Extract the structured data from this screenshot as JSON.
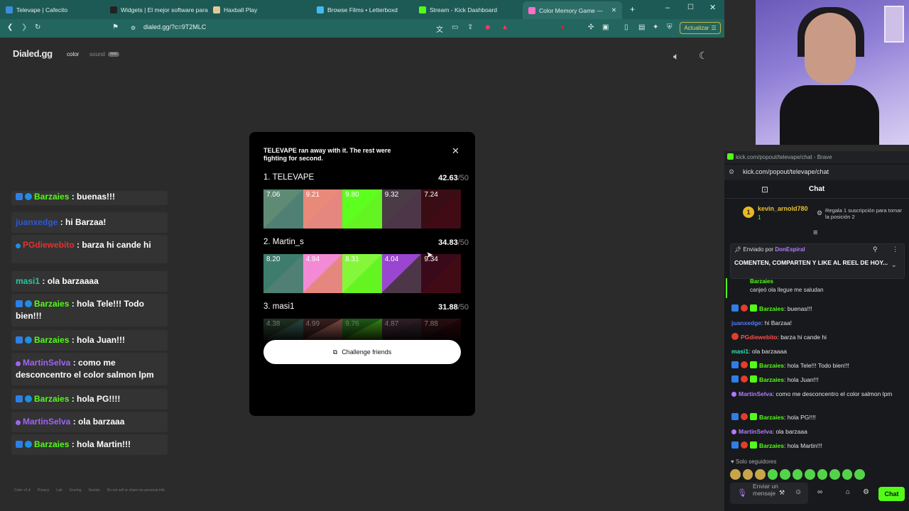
{
  "browser": {
    "tabs": [
      {
        "label": "Televape | Cafecito",
        "color": "#3c8dde"
      },
      {
        "label": "Widgets | El mejor software para",
        "color": "#222222"
      },
      {
        "label": "Haxball Play",
        "color": "#e3c89a"
      },
      {
        "label": "Browse Films • Letterboxd",
        "color": "#40bcf4"
      },
      {
        "label": "Stream - Kick Dashboard",
        "color": "#53fc18"
      },
      {
        "label": "Color Memory Game —",
        "color": "#ff6ec7"
      }
    ],
    "url": "dialed.gg/?c=9T2MLC",
    "update_label": "Actualizar"
  },
  "site": {
    "logo": "Dialed.gg",
    "nav_color": "color",
    "nav_sound": "sound",
    "new_badge": "new",
    "footer": [
      "Color v1.4",
      "Privacy",
      "Lab",
      "Scoring",
      "Socials",
      "Do not sell or share my personal info"
    ]
  },
  "overlay_chat": [
    {
      "user": "Barzaies",
      "color": "#53fc18",
      "text": "buenas!!!"
    },
    {
      "user": "juanxedge",
      "color": "#2f58d6",
      "text": "hi Barzaa!"
    },
    {
      "user": "PGdiewebito",
      "color": "#e8302c",
      "text": "barza hi cande hi"
    },
    {
      "user": "masi1",
      "color": "#25c8a0",
      "text": "ola barzaaaa"
    },
    {
      "user": "Barzaies",
      "color": "#53fc18",
      "text": "hola Tele!!! Todo bien!!!"
    },
    {
      "user": "Barzaies",
      "color": "#53fc18",
      "text": "hola Juan!!!"
    },
    {
      "user": "MartinSelva",
      "color": "#a063f2",
      "text": "como me desconcentro el color salmon lpm"
    },
    {
      "user": "Barzaies",
      "color": "#53fc18",
      "text": "hola PG!!!!"
    },
    {
      "user": "MartinSelva",
      "color": "#a063f2",
      "text": "ola barzaaa"
    },
    {
      "user": "Barzaies",
      "color": "#53fc18",
      "text": "hola Martin!!!"
    }
  ],
  "modal": {
    "title": "TELEVAPE ran away with it. The rest were fighting for second.",
    "max": "/50",
    "challenge_label": "Challenge friends",
    "players": [
      {
        "rank": "1. TELEVAPE",
        "score": "42.63",
        "scores": [
          "7.06",
          "9.21",
          "9.80",
          "9.32",
          "7.24"
        ],
        "colors": [
          "#5f8a74",
          "#e8897a",
          "#5dff1f",
          "#4a3b47",
          "#3a0d14"
        ],
        "guesses": [
          "#4f8073",
          "#e5877e",
          "#63f422",
          "#4d3648",
          "#410b16"
        ]
      },
      {
        "rank": "2. Martin_s",
        "score": "34.83",
        "scores": [
          "8.20",
          "4.94",
          "8.31",
          "4.04",
          "9.34"
        ],
        "colors": [
          "#3e7d6d",
          "#f38ad6",
          "#85f73b",
          "#9a46d0",
          "#3b0a1a"
        ],
        "guesses": [
          "#4f8073",
          "#e5877e",
          "#63f422",
          "#4d3648",
          "#410b16"
        ]
      },
      {
        "rank": "3. masi1",
        "score": "31.88",
        "scores": [
          "4.38",
          "4.99",
          "9.76",
          "4.87",
          "7.88"
        ],
        "colors": [
          "#3a5a3f",
          "#6a3a3a",
          "#3aa62a",
          "#5a3a4a",
          "#4a1a20"
        ],
        "guesses": [
          "#4f8073",
          "#e5877e",
          "#63f422",
          "#4d3648",
          "#410b16"
        ]
      }
    ]
  },
  "kick": {
    "window_title": "kick.com/popout/televape/chat - Brave",
    "address": "kick.com/popout/televape/chat",
    "tab_label": "Chat",
    "gifter_name": "kevin_arnold780",
    "gifter_count": "1",
    "gift_prompt": "Regala 1 suscripción para tomar la posición 2",
    "pinned_by": "Enviado por",
    "pinned_user": "DonEspiral",
    "pinned_text": "COMENTEN, COMPARTEN Y LIKE AL REEL DE HOY...",
    "redeem_user": "Barzaies",
    "redeem_text": "canjeó ola llegue me saludan",
    "messages": [
      {
        "user": "Barzaies",
        "color": "#53fc18",
        "text": ": buenas!!!"
      },
      {
        "user": "juanxedge",
        "color": "#4f7bff",
        "text": ": hi Barzaa!"
      },
      {
        "user": "PGdiewebito",
        "color": "#ff4d4d",
        "text": ": barza hi cande hi"
      },
      {
        "user": "masi1",
        "color": "#2ee6b6",
        "text": ": ola barzaaaa"
      },
      {
        "user": "Barzaies",
        "color": "#53fc18",
        "text": ": hola Tele!!! Todo bien!!!"
      },
      {
        "user": "Barzaies",
        "color": "#53fc18",
        "text": ": hola Juan!!!"
      },
      {
        "user": "MartinSelva",
        "color": "#b07bff",
        "text": ": como me desconcentro el color salmon lpm"
      },
      {
        "user": "Barzaies",
        "color": "#53fc18",
        "text": ": hola PG!!!!"
      },
      {
        "user": "MartinSelva",
        "color": "#b07bff",
        "text": ": ola barzaaa"
      },
      {
        "user": "Barzaies",
        "color": "#53fc18",
        "text": ": hola Martin!!!"
      }
    ],
    "followers_only": "Solo seguidores",
    "input_placeholder": "Enviar un mensaje",
    "send_label": "Chat"
  }
}
